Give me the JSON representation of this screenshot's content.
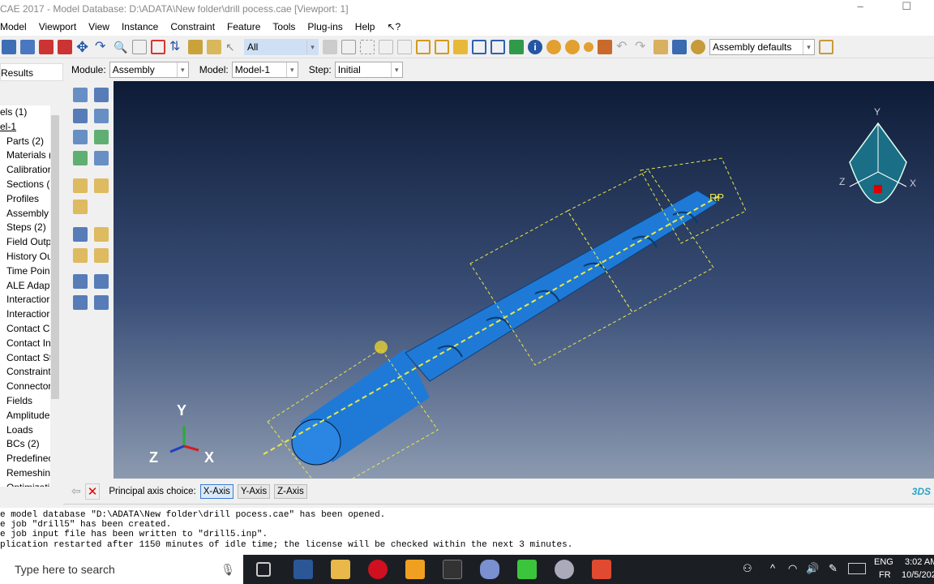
{
  "window": {
    "title": "CAE 2017 - Model Database: D:\\ADATA\\New folder\\drill pocess.cae [Viewport: 1]",
    "controls": "–  ☐"
  },
  "menu": [
    "Model",
    "Viewport",
    "View",
    "Instance",
    "Constraint",
    "Feature",
    "Tools",
    "Plug-ins",
    "Help",
    "↖?"
  ],
  "toolbar": {
    "selection_filter": "All",
    "render_style": "Assembly defaults"
  },
  "context": {
    "results_tab": "Results",
    "module_label": "Module:",
    "module": "Assembly",
    "model_label": "Model:",
    "model": "Model-1",
    "step_label": "Step:",
    "step": "Initial"
  },
  "tree": [
    "els (1)",
    "el-1",
    "Parts (2)",
    "Materials (",
    "Calibratior",
    "Sections (2",
    "Profiles",
    "Assembly",
    "Steps (2)",
    "Field Outp",
    "History Ou",
    "Time Poin",
    "ALE Adapt",
    "Interactior",
    "Interactior",
    "Contact Co",
    "Contact In",
    "Contact St",
    "Constraint",
    "Connector",
    "Fields",
    "Amplitude",
    "Loads",
    "BCs (2)",
    "Predefinec",
    "Remeshing",
    "Optimizati"
  ],
  "viewport": {
    "triad": {
      "x": "X",
      "y": "Y",
      "z": "Z"
    },
    "view_cube": {
      "x": "X",
      "y": "Y",
      "z": "Z"
    },
    "ref_point_label": "RP",
    "part_color": "#1e7ad6",
    "datum_color": "#e8e84a",
    "logo": "3DS"
  },
  "prompt": {
    "label": "Principal axis choice:",
    "options": [
      "X-Axis",
      "Y-Axis",
      "Z-Axis"
    ],
    "selected": "X-Axis"
  },
  "messages": [
    "e model database \"D:\\ADATA\\New folder\\drill pocess.cae\" has been opened.",
    "e job \"drill5\" has been created.",
    "e job input file has been written to \"drill5.inp\".",
    "plication restarted after 1150 minutes of idle time; the license will be checked within the next 3 minutes."
  ],
  "taskbar": {
    "search_placeholder": "Type here to search",
    "lang1": "ENG",
    "lang2": "FR",
    "time": "3:02 AM",
    "date": "10/5/202"
  }
}
